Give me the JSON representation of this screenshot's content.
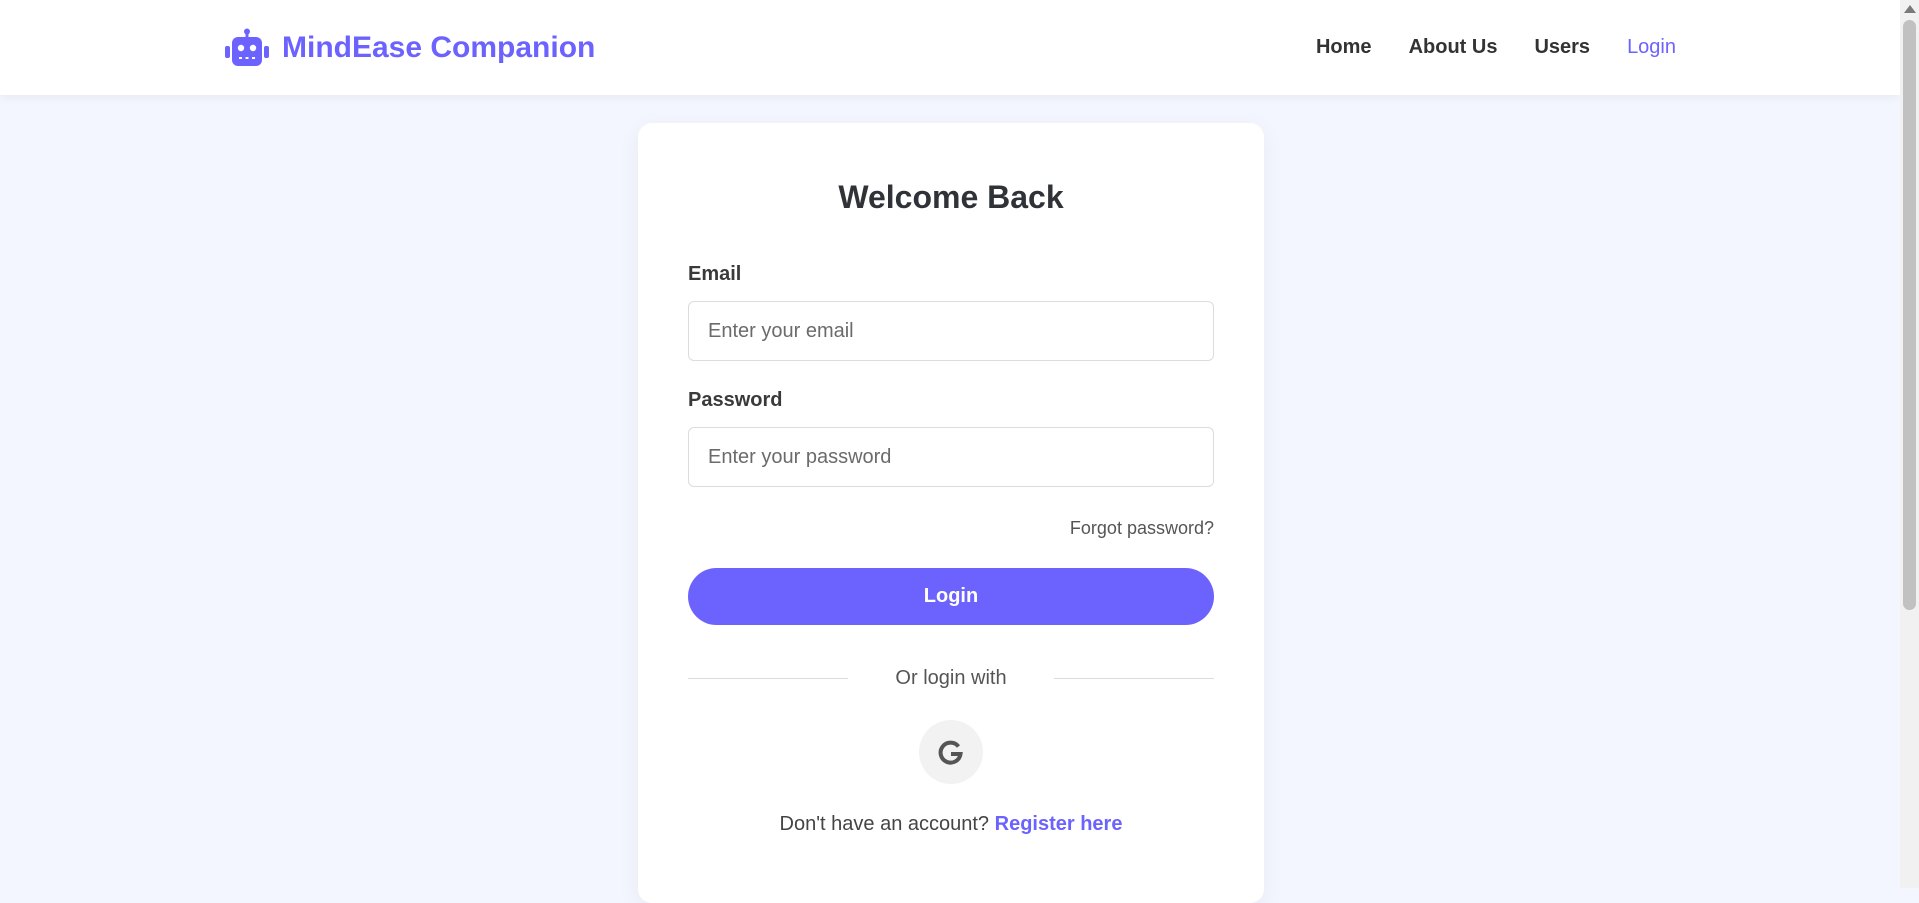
{
  "brand": {
    "name": "MindEase Companion",
    "icon": "robot-icon",
    "color": "#6c63ff"
  },
  "nav": {
    "items": [
      {
        "label": "Home"
      },
      {
        "label": "About Us"
      },
      {
        "label": "Users"
      },
      {
        "label": "Login",
        "active": true
      }
    ]
  },
  "login": {
    "title": "Welcome Back",
    "email": {
      "label": "Email",
      "placeholder": "Enter your email",
      "value": ""
    },
    "password": {
      "label": "Password",
      "placeholder": "Enter your password",
      "value": ""
    },
    "forgot": "Forgot password?",
    "submit": "Login",
    "divider": "Or login with",
    "social": [
      {
        "icon": "google-icon"
      }
    ],
    "register_prompt": "Don't have an account?",
    "register_link": "Register here"
  },
  "colors": {
    "accent": "#6c63ff",
    "background": "#f3f6fe",
    "card": "#ffffff"
  }
}
